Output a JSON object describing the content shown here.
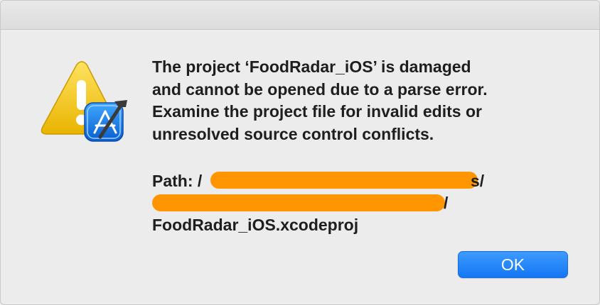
{
  "dialog": {
    "message": "The project ‘FoodRadar_iOS’ is damaged\nand cannot be opened due to a parse error.\nExamine the project file for invalid edits or\nunresolved source control conflicts.",
    "path": {
      "label": "Path:",
      "line1_start": "/",
      "line1_end": "s/",
      "line2_end": "/",
      "filename": "FoodRadar_iOS.xcodeproj"
    },
    "redaction_color": "#ff9500",
    "icon": "warning-triangle-with-xcode-badge"
  },
  "buttons": {
    "ok_label": "OK"
  },
  "colors": {
    "accent": "#1476f5",
    "warning": "#f2c313"
  }
}
